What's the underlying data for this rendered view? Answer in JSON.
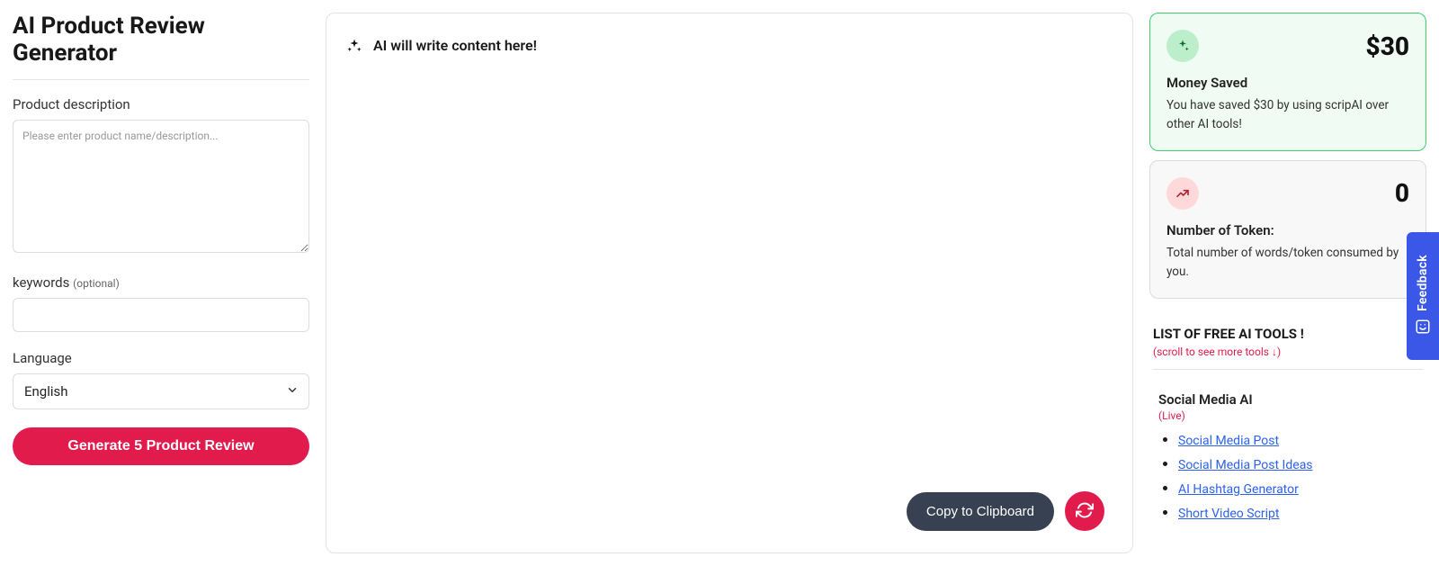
{
  "page": {
    "title": "AI Product Review Generator"
  },
  "form": {
    "description_label": "Product description",
    "description_placeholder": "Please enter product name/description...",
    "keywords_label": "keywords",
    "keywords_optional": "(optional)",
    "language_label": "Language",
    "language_value": "English",
    "generate_label": "Generate 5 Product Review"
  },
  "output": {
    "placeholder": "AI will write content here!"
  },
  "actions": {
    "copy_label": "Copy to Clipboard"
  },
  "cards": {
    "saved": {
      "value": "$30",
      "title": "Money Saved",
      "text": "You have saved $30 by using scripAI over other AI tools!"
    },
    "tokens": {
      "value": "0",
      "title": "Number of Token:",
      "text": "Total number of words/token consumed by you."
    }
  },
  "tools": {
    "heading": "LIST OF FREE AI TOOLS !",
    "hint": "(scroll to see more tools ↓)",
    "group_title": "Social Media AI",
    "group_live": "(Live)",
    "items": [
      "Social Media Post",
      "Social Media Post Ideas",
      "AI Hashtag Generator",
      "Short Video Script"
    ]
  },
  "feedback": {
    "label": "Feedback"
  }
}
